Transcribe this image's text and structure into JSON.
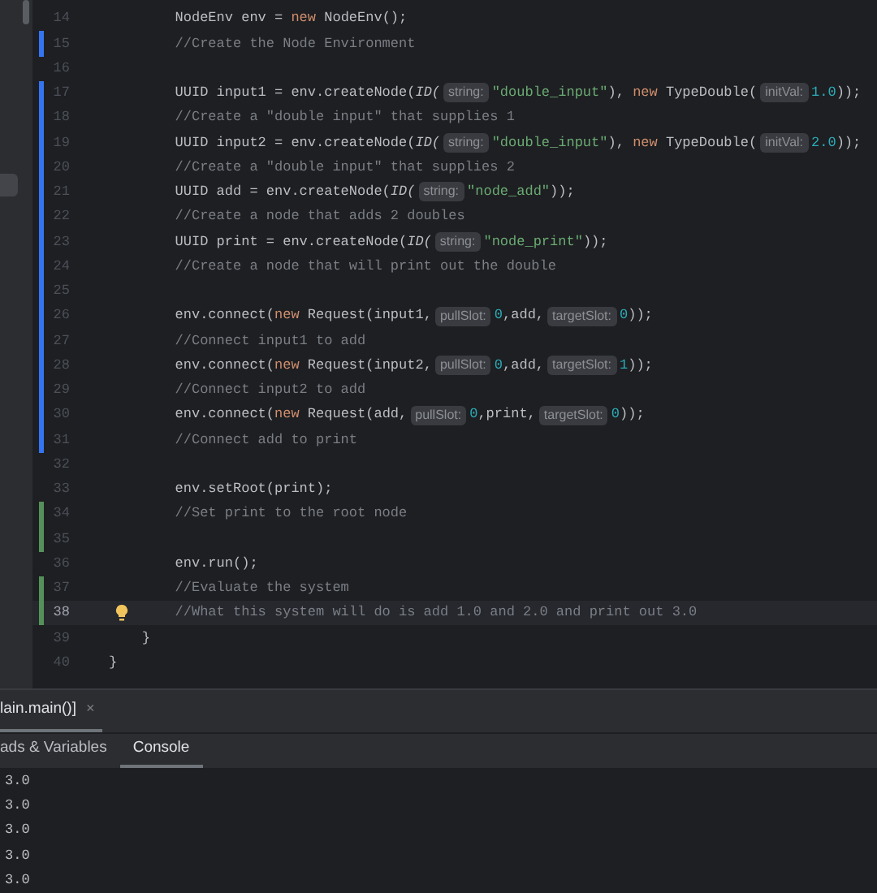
{
  "editor": {
    "lines": [
      {
        "number": "14",
        "in_class": true,
        "in_method": true,
        "current": false,
        "tokens": [
          {
            "kind": "plain",
            "text": "NodeEnv env = "
          },
          {
            "kind": "keyword",
            "text": "new"
          },
          {
            "kind": "plain",
            "text": " NodeEnv();"
          }
        ]
      },
      {
        "number": "15",
        "color": "#3574f0",
        "in_class": true,
        "in_method": true,
        "current": false,
        "tokens": [
          {
            "kind": "comment",
            "text": "//Create the Node Environment"
          }
        ]
      },
      {
        "number": "16",
        "current": false
      },
      {
        "number": "17",
        "color": "#3574f0",
        "in_class": true,
        "in_method": true,
        "current": false,
        "tokens": [
          {
            "kind": "plain",
            "text": "UUID input1 = env.createNode("
          },
          {
            "kind": "italic",
            "text": "ID("
          },
          {
            "kind": "hint",
            "text": "string:"
          },
          {
            "kind": "string",
            "text": "\"double_input\""
          },
          {
            "kind": "plain",
            "text": "), "
          },
          {
            "kind": "keyword",
            "text": "new"
          },
          {
            "kind": "plain",
            "text": " TypeDouble("
          },
          {
            "kind": "hint",
            "text": "initVal:"
          },
          {
            "kind": "number",
            "text": "1.0"
          },
          {
            "kind": "plain",
            "text": "));"
          }
        ]
      },
      {
        "number": "18",
        "color": "#3574f0",
        "in_class": true,
        "in_method": true,
        "current": false,
        "tokens": [
          {
            "kind": "comment",
            "text": "//Create a \"double input\" that supplies 1"
          }
        ]
      },
      {
        "number": "19",
        "color": "#3574f0",
        "in_class": true,
        "in_method": true,
        "current": false,
        "tokens": [
          {
            "kind": "plain",
            "text": "UUID input2 = env.createNode("
          },
          {
            "kind": "italic",
            "text": "ID("
          },
          {
            "kind": "hint",
            "text": "string:"
          },
          {
            "kind": "string",
            "text": "\"double_input\""
          },
          {
            "kind": "plain",
            "text": "), "
          },
          {
            "kind": "keyword",
            "text": "new"
          },
          {
            "kind": "plain",
            "text": " TypeDouble("
          },
          {
            "kind": "hint",
            "text": "initVal:"
          },
          {
            "kind": "number",
            "text": "2.0"
          },
          {
            "kind": "plain",
            "text": "));"
          }
        ]
      },
      {
        "number": "20",
        "color": "#3574f0",
        "in_class": true,
        "in_method": true,
        "current": false,
        "tokens": [
          {
            "kind": "comment",
            "text": "//Create a \"double input\" that supplies 2"
          }
        ]
      },
      {
        "number": "21",
        "color": "#3574f0",
        "in_class": true,
        "in_method": true,
        "current": false,
        "tokens": [
          {
            "kind": "plain",
            "text": "UUID add = env.createNode("
          },
          {
            "kind": "italic",
            "text": "ID("
          },
          {
            "kind": "hint",
            "text": "string:"
          },
          {
            "kind": "string",
            "text": "\"node_add\""
          },
          {
            "kind": "plain",
            "text": "));"
          }
        ]
      },
      {
        "number": "22",
        "color": "#3574f0",
        "in_class": true,
        "in_method": true,
        "current": false,
        "tokens": [
          {
            "kind": "comment",
            "text": "//Create a node that adds 2 doubles"
          }
        ]
      },
      {
        "number": "23",
        "color": "#3574f0",
        "in_class": true,
        "in_method": true,
        "current": false,
        "tokens": [
          {
            "kind": "plain",
            "text": "UUID print = env.createNode("
          },
          {
            "kind": "italic",
            "text": "ID("
          },
          {
            "kind": "hint",
            "text": "string:"
          },
          {
            "kind": "string",
            "text": "\"node_print\""
          },
          {
            "kind": "plain",
            "text": "));"
          }
        ]
      },
      {
        "number": "24",
        "color": "#3574f0",
        "in_class": true,
        "in_method": true,
        "current": false,
        "tokens": [
          {
            "kind": "comment",
            "text": "//Create a node that will print out the double"
          }
        ]
      },
      {
        "number": "25",
        "color": "#3574f0",
        "current": false
      },
      {
        "number": "26",
        "color": "#3574f0",
        "in_class": true,
        "in_method": true,
        "current": false,
        "tokens": [
          {
            "kind": "plain",
            "text": "env.connect("
          },
          {
            "kind": "keyword",
            "text": "new"
          },
          {
            "kind": "plain",
            "text": " Request(input1,"
          },
          {
            "kind": "hint",
            "text": "pullSlot:"
          },
          {
            "kind": "number",
            "text": "0"
          },
          {
            "kind": "plain",
            "text": ",add,"
          },
          {
            "kind": "hint",
            "text": "targetSlot:"
          },
          {
            "kind": "number",
            "text": "0"
          },
          {
            "kind": "plain",
            "text": "));"
          }
        ]
      },
      {
        "number": "27",
        "color": "#3574f0",
        "in_class": true,
        "in_method": true,
        "current": false,
        "tokens": [
          {
            "kind": "comment",
            "text": "//Connect input1 to add"
          }
        ]
      },
      {
        "number": "28",
        "color": "#3574f0",
        "in_class": true,
        "in_method": true,
        "current": false,
        "tokens": [
          {
            "kind": "plain",
            "text": "env.connect("
          },
          {
            "kind": "keyword",
            "text": "new"
          },
          {
            "kind": "plain",
            "text": " Request(input2,"
          },
          {
            "kind": "hint",
            "text": "pullSlot:"
          },
          {
            "kind": "number",
            "text": "0"
          },
          {
            "kind": "plain",
            "text": ",add,"
          },
          {
            "kind": "hint",
            "text": "targetSlot:"
          },
          {
            "kind": "number",
            "text": "1"
          },
          {
            "kind": "plain",
            "text": "));"
          }
        ]
      },
      {
        "number": "29",
        "color": "#3574f0",
        "in_class": true,
        "in_method": true,
        "current": false,
        "tokens": [
          {
            "kind": "comment",
            "text": "//Connect input2 to add"
          }
        ]
      },
      {
        "number": "30",
        "color": "#3574f0",
        "in_class": true,
        "in_method": true,
        "current": false,
        "tokens": [
          {
            "kind": "plain",
            "text": "env.connect("
          },
          {
            "kind": "keyword",
            "text": "new"
          },
          {
            "kind": "plain",
            "text": " Request(add,"
          },
          {
            "kind": "hint",
            "text": "pullSlot:"
          },
          {
            "kind": "number",
            "text": "0"
          },
          {
            "kind": "plain",
            "text": ",print,"
          },
          {
            "kind": "hint",
            "text": "targetSlot:"
          },
          {
            "kind": "number",
            "text": "0"
          },
          {
            "kind": "plain",
            "text": "));"
          }
        ]
      },
      {
        "number": "31",
        "color": "#3574f0",
        "in_class": true,
        "in_method": true,
        "current": false,
        "tokens": [
          {
            "kind": "comment",
            "text": "//Connect add to print"
          }
        ]
      },
      {
        "number": "32",
        "current": false
      },
      {
        "number": "33",
        "in_class": true,
        "in_method": true,
        "current": false,
        "tokens": [
          {
            "kind": "plain",
            "text": "env.setRoot(print);"
          }
        ]
      },
      {
        "number": "34",
        "color": "#549159",
        "in_class": true,
        "in_method": true,
        "current": false,
        "tokens": [
          {
            "kind": "comment",
            "text": "//Set print to the root node"
          }
        ]
      },
      {
        "number": "35",
        "color": "#549159",
        "current": false
      },
      {
        "number": "36",
        "in_class": true,
        "in_method": true,
        "current": false,
        "tokens": [
          {
            "kind": "plain",
            "text": "env.run();"
          }
        ]
      },
      {
        "number": "37",
        "color": "#549159",
        "in_class": true,
        "in_method": true,
        "current": false,
        "tokens": [
          {
            "kind": "comment",
            "text": "//Evaluate the system"
          }
        ]
      },
      {
        "number": "38",
        "color": "#549159",
        "in_class": true,
        "in_method": true,
        "current": true,
        "bulb": true,
        "tokens": [
          {
            "kind": "comment",
            "text": "//What this system will do is add 1.0 and 2.0 and print out 3.0"
          }
        ]
      },
      {
        "number": "39",
        "in_class": true,
        "in_method": false,
        "current": false,
        "tokens": [
          {
            "kind": "plain",
            "text": "}"
          }
        ]
      },
      {
        "number": "40",
        "in_class": false,
        "in_method": false,
        "current": false,
        "tokens": [
          {
            "kind": "plain",
            "text": "}"
          }
        ]
      }
    ]
  },
  "debug_panel": {
    "session_tab": {
      "label": "lain.main()]",
      "close": "×"
    },
    "tabs": [
      {
        "label": "ads & Variables",
        "selected": false
      },
      {
        "label": "Console",
        "selected": true
      }
    ],
    "console_lines": [
      "3.0",
      "3.0",
      "3.0",
      "3.0",
      "3.0"
    ]
  }
}
